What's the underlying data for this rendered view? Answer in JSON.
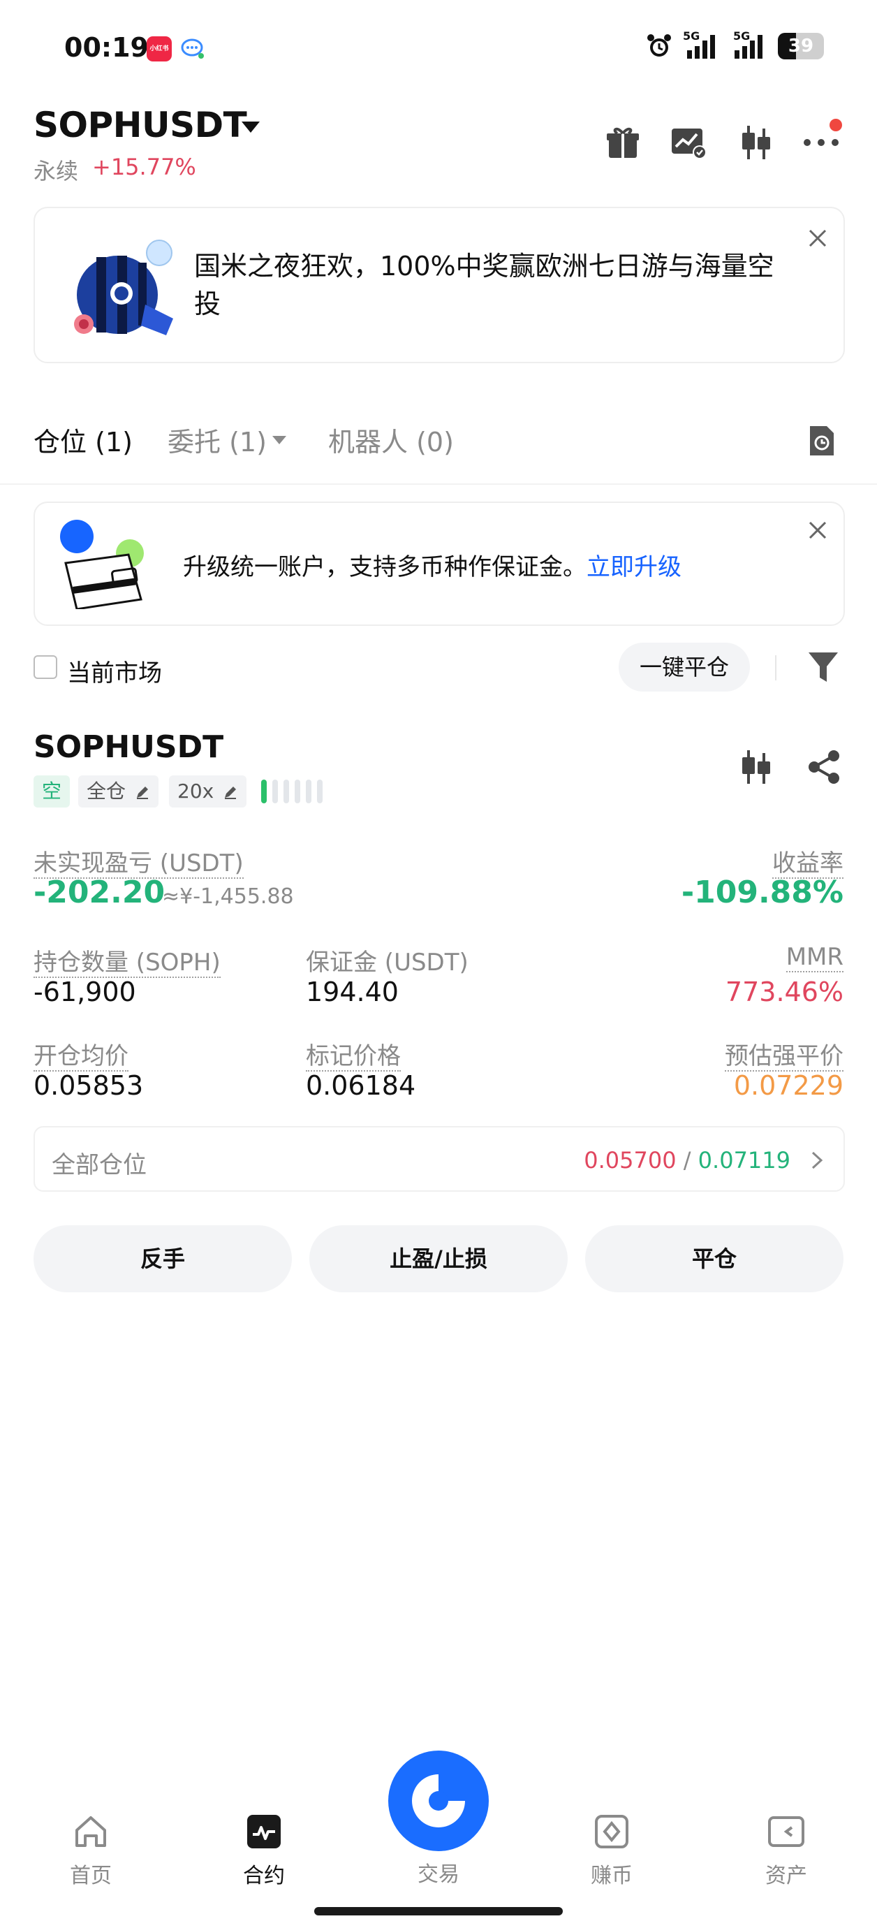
{
  "status_bar": {
    "time": "00:19",
    "app_badge_text": "小红书",
    "signal_1": "5G",
    "signal_2": "5G",
    "battery": "39",
    "battery_level": 0.39
  },
  "header": {
    "symbol": "SOPHUSDT",
    "contract_type": "永续",
    "change": "+15.77%",
    "icons": [
      "gift-icon",
      "chart-check-icon",
      "candlestick-icon",
      "more-icon"
    ]
  },
  "promo_banner": {
    "text": "国米之夜狂欢，100%中奖赢欧洲七日游与海量空投"
  },
  "tabs": {
    "positions": "仓位 (1)",
    "orders": "委托 (1)",
    "bots": "机器人 (0)"
  },
  "upgrade_banner": {
    "text": "升级统一账户，支持多币种作保证金。",
    "link": "立即升级"
  },
  "filter": {
    "current_market": "当前市场",
    "close_all": "一键平仓"
  },
  "position": {
    "symbol": "SOPHUSDT",
    "side": "空",
    "margin_mode": "全仓",
    "leverage": "20x",
    "unrealized_pnl_label": "未实现盈亏 (USDT)",
    "unrealized_pnl": "-202.20",
    "unrealized_pnl_cny": "≈¥-1,455.88",
    "roe_label": "收益率",
    "roe": "-109.88%",
    "size_label": "持仓数量 (SOPH)",
    "size": "-61,900",
    "margin_label": "保证金 (USDT)",
    "margin": "194.40",
    "mmr_label": "MMR",
    "mmr": "773.46%",
    "entry_label": "开仓均价",
    "entry_price": "0.05853",
    "mark_label": "标记价格",
    "mark_price": "0.06184",
    "liq_label": "预估强平价",
    "liq_price": "0.07229",
    "all_positions_label": "全部仓位",
    "tp_price": "0.05700",
    "sl_separator": "/",
    "sl_price": "0.07119"
  },
  "actions": {
    "reverse": "反手",
    "tpsl": "止盈/止损",
    "close": "平仓"
  },
  "bottom_nav": {
    "home": "首页",
    "futures": "合约",
    "trade": "交易",
    "earn": "赚币",
    "assets": "资产"
  }
}
